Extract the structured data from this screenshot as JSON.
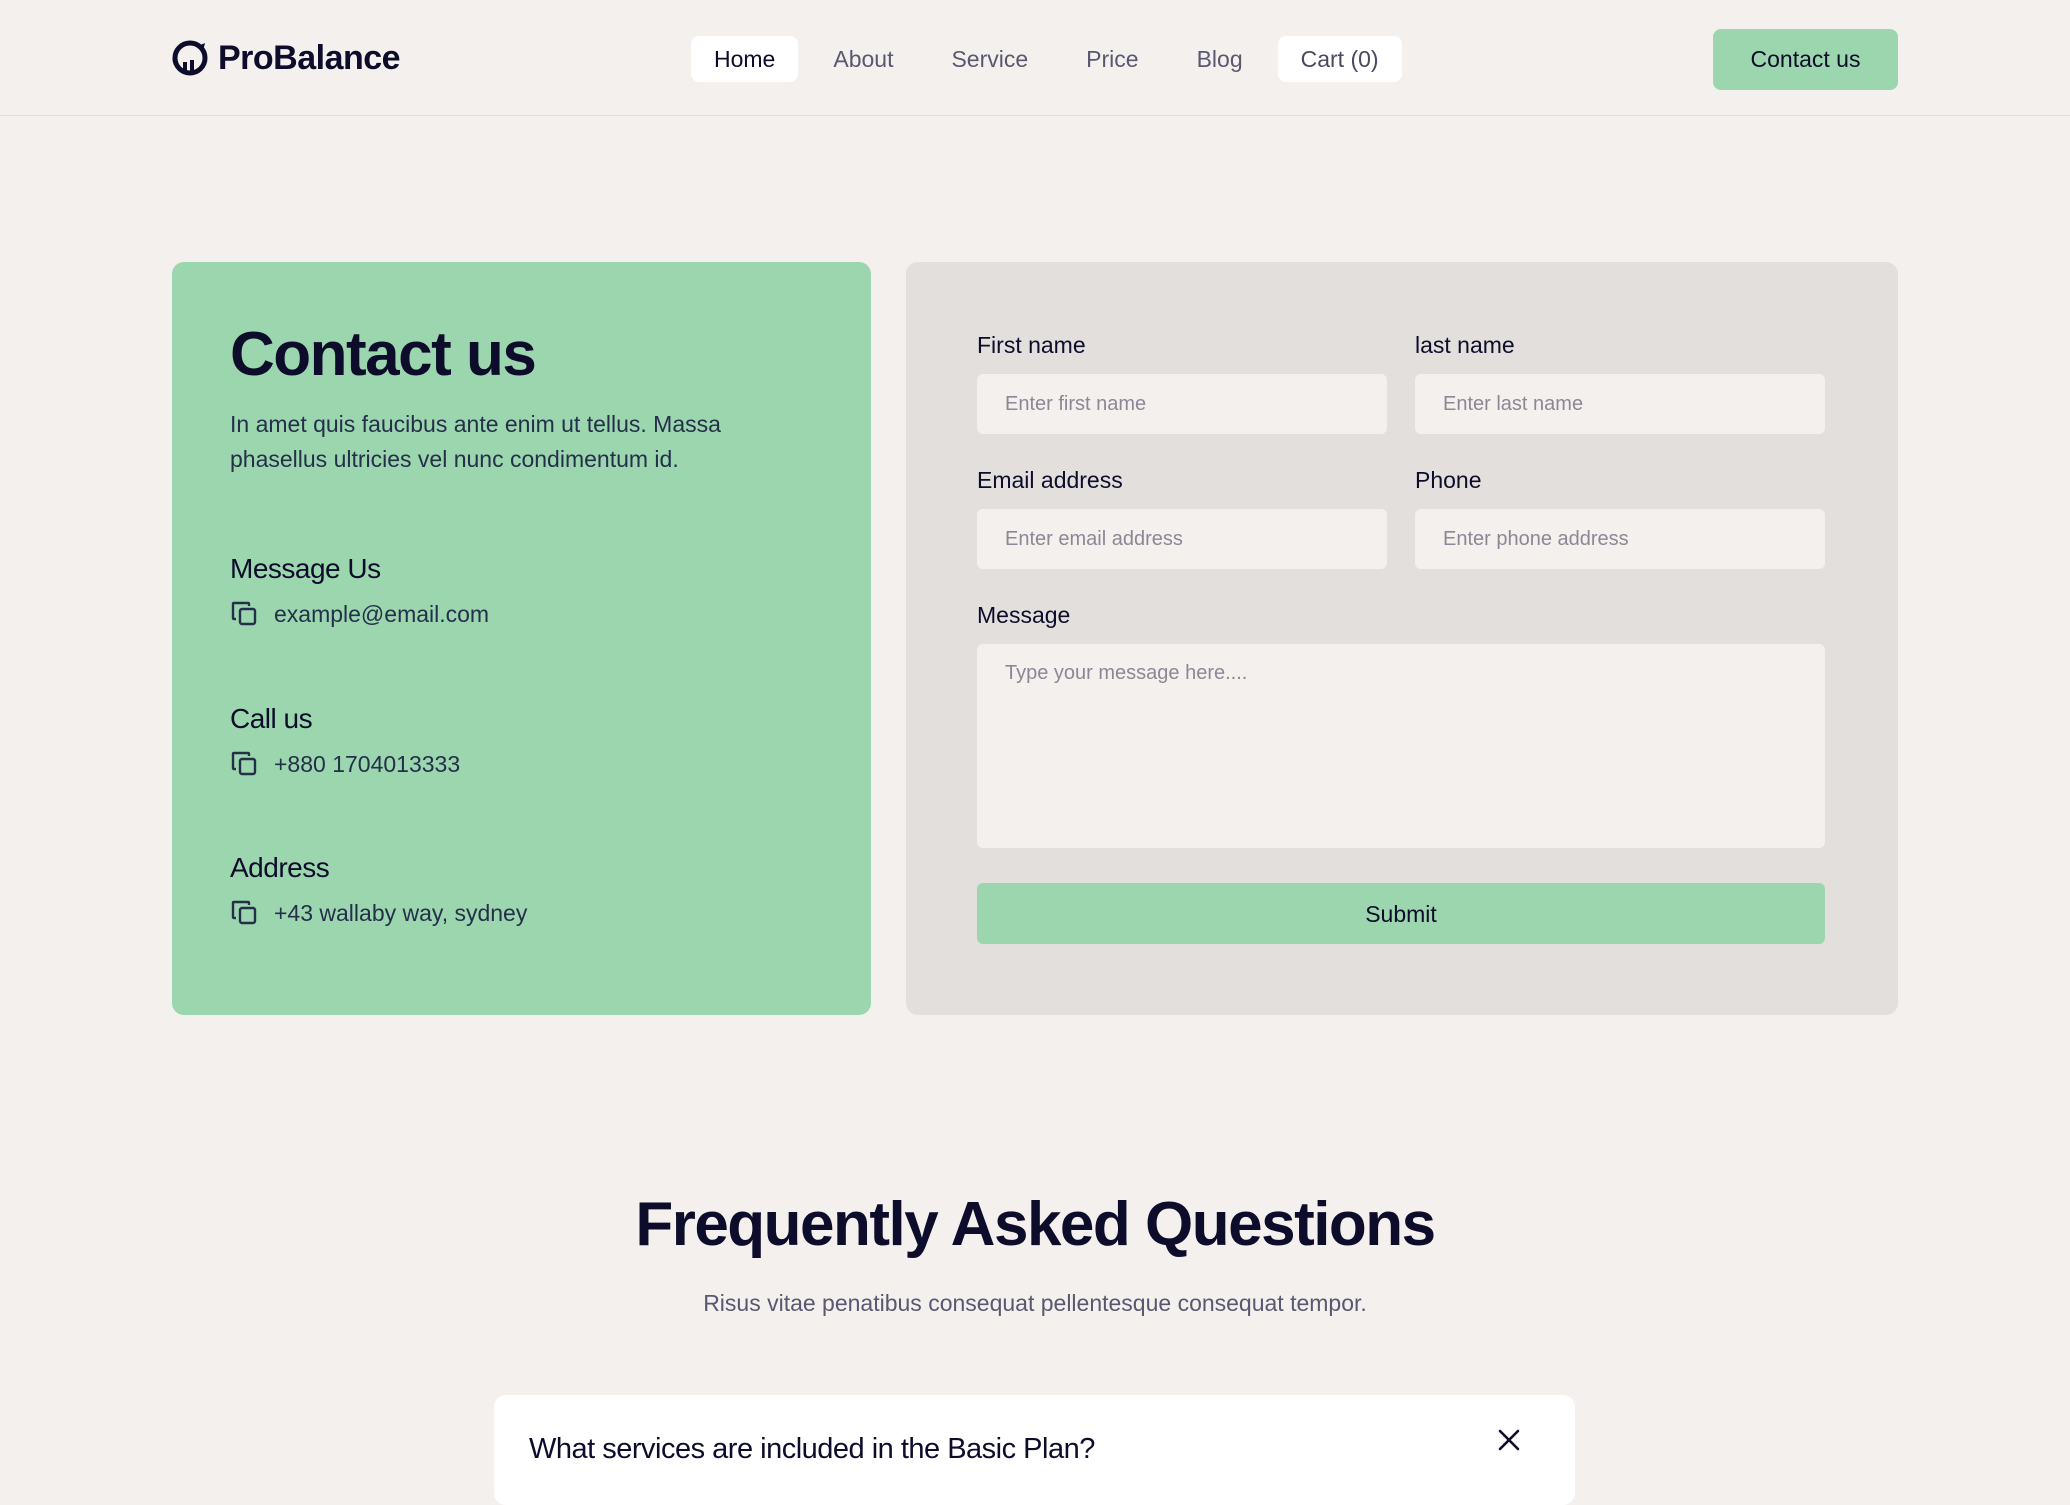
{
  "brand": {
    "name": "ProBalance",
    "logo_icon": "half-circle-chart-icon"
  },
  "nav": {
    "items": [
      {
        "label": "Home",
        "active": true
      },
      {
        "label": "About"
      },
      {
        "label": "Service"
      },
      {
        "label": "Price"
      },
      {
        "label": "Blog"
      },
      {
        "label": "Cart (0)"
      }
    ],
    "cta_label": "Contact us"
  },
  "contact": {
    "title": "Contact us",
    "description": "In amet quis faucibus ante enim ut tellus. Massa phasellus ultricies vel nunc condimentum id.",
    "message": {
      "title": "Message Us",
      "value": "example@email.com",
      "icon": "copy-icon"
    },
    "call": {
      "title": "Call us",
      "value": "+880 1704013333",
      "icon": "copy-icon"
    },
    "address": {
      "title": "Address",
      "value": "+43 wallaby way, sydney",
      "icon": "copy-icon"
    }
  },
  "form": {
    "first_name": {
      "label": "First name",
      "placeholder": "Enter first name",
      "value": ""
    },
    "last_name": {
      "label": "last name",
      "placeholder": "Enter last name",
      "value": ""
    },
    "email": {
      "label": "Email address",
      "placeholder": "Enter email address",
      "value": ""
    },
    "phone": {
      "label": "Phone",
      "placeholder": "Enter phone address",
      "value": ""
    },
    "message": {
      "label": "Message",
      "placeholder": "Type your message here....",
      "value": ""
    },
    "submit_label": "Submit"
  },
  "faq": {
    "title": "Frequently Asked Questions",
    "subtitle": "Risus vitae penatibus consequat pellentesque consequat tempor.",
    "items": [
      {
        "question": "What services are included in the Basic Plan?",
        "icon": "close-icon"
      }
    ]
  },
  "colors": {
    "background": "#f4f0ed",
    "accent_green": "#9cd6ae",
    "form_panel": "#e3dfdc",
    "text_dark": "#0d0c2b"
  }
}
